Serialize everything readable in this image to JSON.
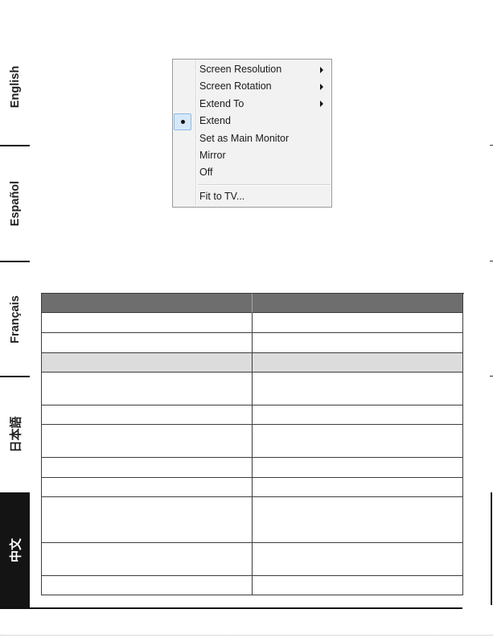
{
  "sidebar": {
    "tabs": [
      {
        "label": "English",
        "active": false
      },
      {
        "label": "Español",
        "active": false
      },
      {
        "label": "Français",
        "active": false
      },
      {
        "label": "日本語",
        "active": false
      },
      {
        "label": "中文",
        "active": true
      }
    ]
  },
  "context_menu": {
    "items": [
      {
        "label": "Screen Resolution",
        "submenu": true,
        "checked": false
      },
      {
        "label": "Screen Rotation",
        "submenu": true,
        "checked": false
      },
      {
        "label": "Extend To",
        "submenu": true,
        "checked": false
      },
      {
        "label": "Extend",
        "submenu": false,
        "checked": true
      },
      {
        "label": "Set as Main Monitor",
        "submenu": false,
        "checked": false
      },
      {
        "label": "Mirror",
        "submenu": false,
        "checked": false
      },
      {
        "label": "Off",
        "submenu": false,
        "checked": false
      },
      {
        "label": "Fit to TV...",
        "submenu": false,
        "checked": false,
        "after_separator": true
      }
    ]
  },
  "table": {
    "header": [
      "",
      ""
    ],
    "rows": [
      [
        "",
        ""
      ],
      [
        "",
        ""
      ],
      [
        "",
        ""
      ],
      [
        "",
        ""
      ],
      [
        "",
        ""
      ],
      [
        "",
        ""
      ],
      [
        "",
        ""
      ],
      [
        "",
        ""
      ],
      [
        "",
        ""
      ],
      [
        "",
        ""
      ],
      [
        "",
        ""
      ]
    ]
  },
  "colors": {
    "table_header_bg": "#6e6e6e",
    "table_section_bg": "#dcdcdc",
    "active_tab_bg": "#141414",
    "checked_highlight": "#d6e8f8"
  }
}
